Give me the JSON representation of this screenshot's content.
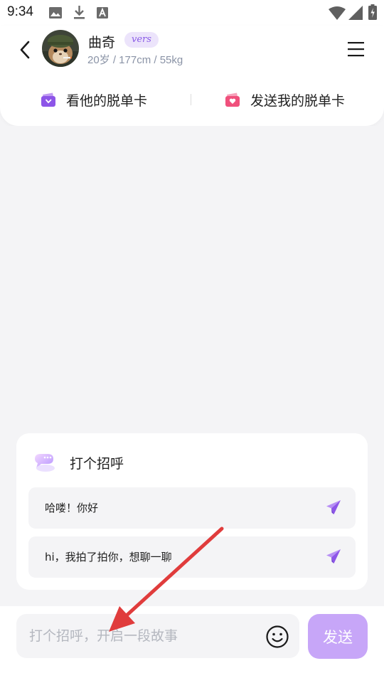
{
  "status_bar": {
    "time": "9:34",
    "icons": [
      "image-icon",
      "download-icon",
      "font-icon",
      "wifi-icon",
      "signal-icon",
      "battery-icon"
    ]
  },
  "header": {
    "back_icon": "chevron-left-icon",
    "user": {
      "name": "曲奇",
      "badge": "vers",
      "stats": "20岁 / 177cm / 55kg"
    },
    "menu_icon": "menu-icon",
    "actions": {
      "view_card": {
        "icon": "card-icon",
        "label": "看他的脱单卡"
      },
      "send_card": {
        "icon": "gift-card-icon",
        "label": "发送我的脱单卡"
      }
    }
  },
  "greeting": {
    "icon": "chat-bubble-icon",
    "title": "打个招呼",
    "options": [
      {
        "text": "哈喽！你好",
        "icon": "send-icon"
      },
      {
        "text": "hi，我拍了拍你，想聊一聊",
        "icon": "send-icon"
      }
    ]
  },
  "composer": {
    "placeholder": "打个招呼，开启一段故事",
    "emoji_icon": "smiley-icon",
    "send_label": "发送"
  },
  "colors": {
    "accent": "#8a5ce6",
    "send_button": "#c7a6f8",
    "badge_bg": "#ece4fb",
    "card_icon": "#8d55e8",
    "gift_icon": "#f0507c",
    "annotation_arrow": "#e03c3c"
  }
}
